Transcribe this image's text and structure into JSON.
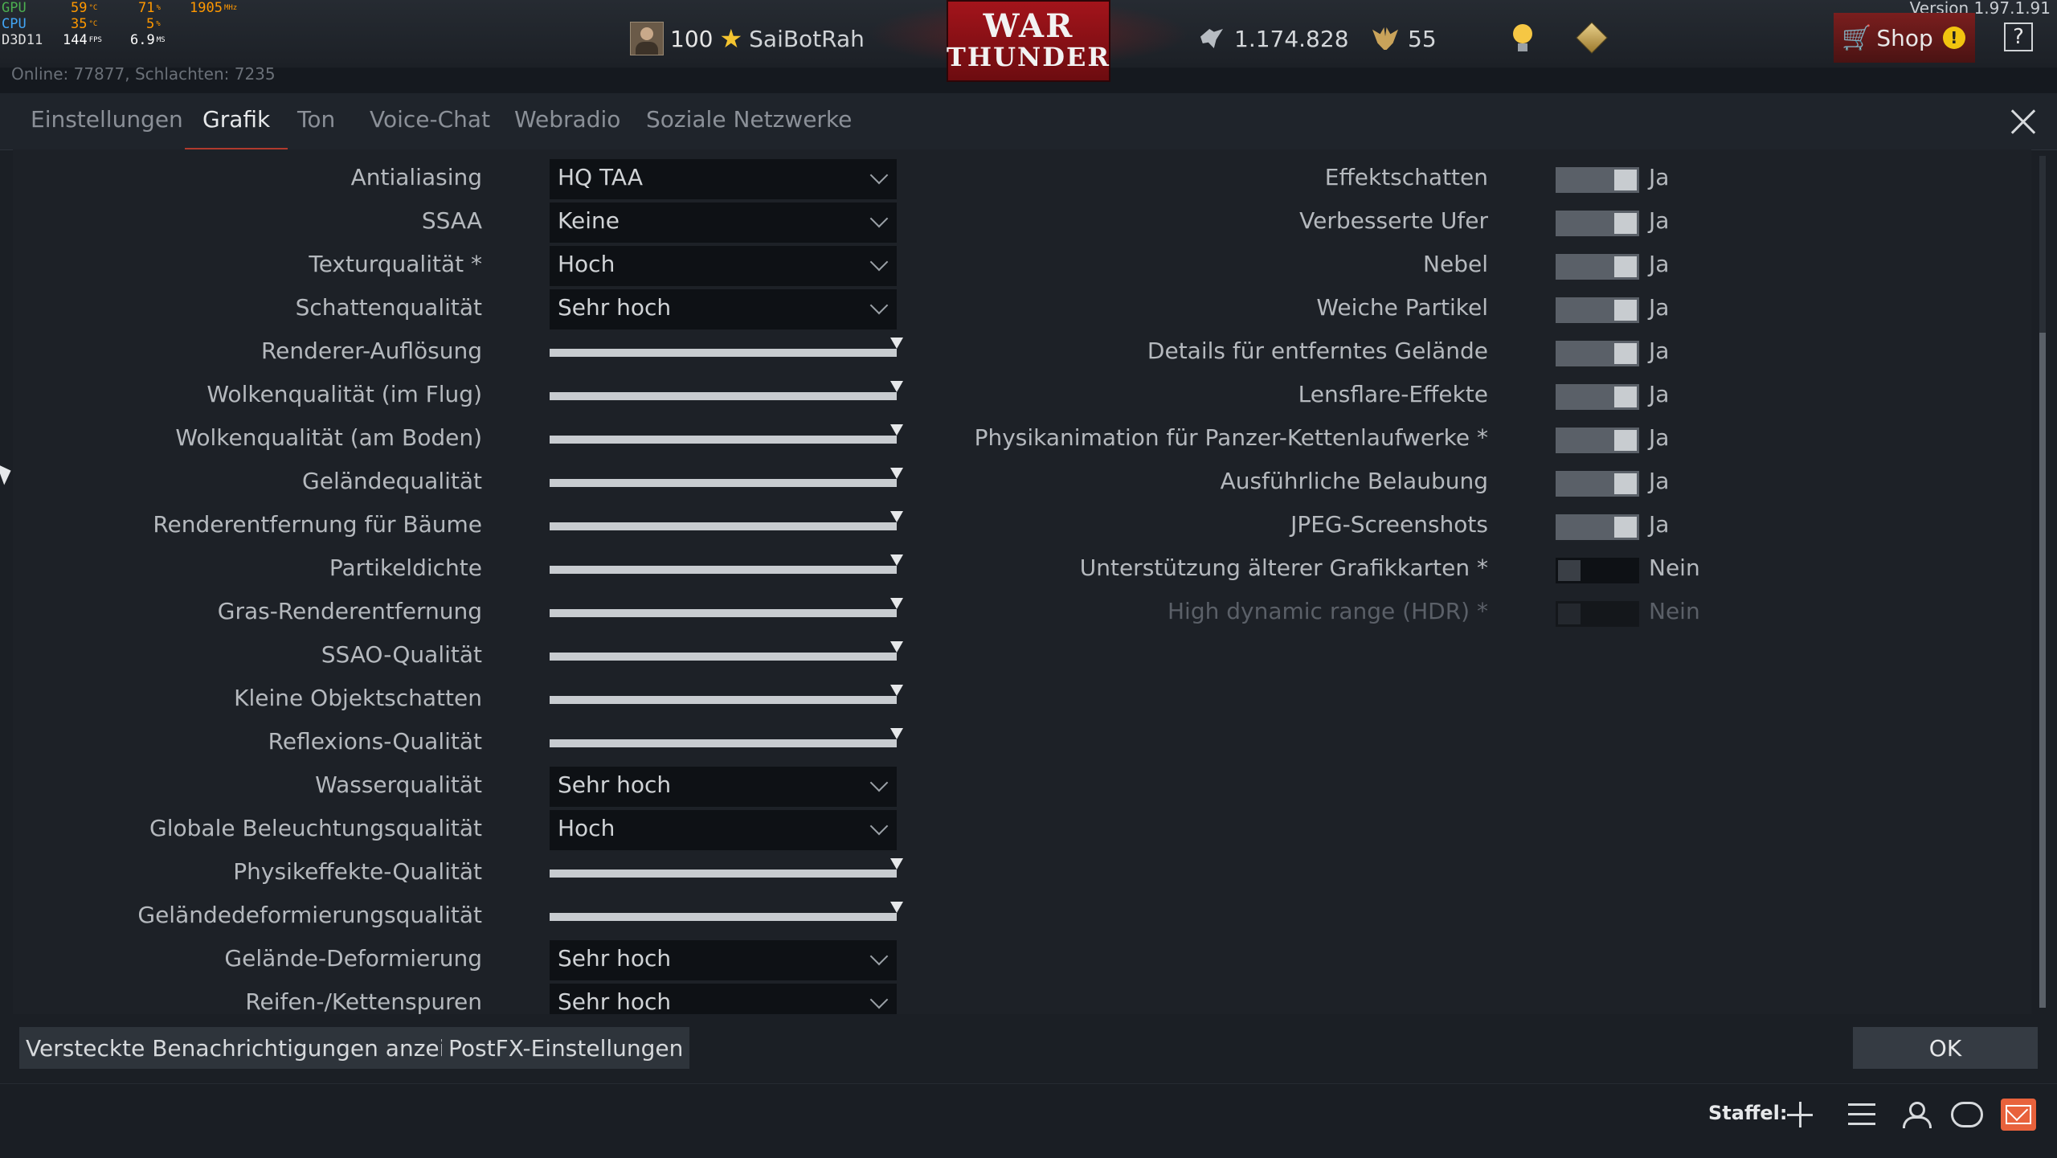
{
  "perf": {
    "gpu": {
      "label": "GPU",
      "temp": "59",
      "temp_unit": "°C",
      "load": "71",
      "load_unit": "%",
      "clock": "1905",
      "clock_unit": "MHz"
    },
    "cpu": {
      "label": "CPU",
      "temp": "35",
      "temp_unit": "°C",
      "load": "5",
      "load_unit": "%"
    },
    "d3d": {
      "label": "D3D11",
      "fps": "144",
      "fps_unit": "FPS",
      "ms": "6.9",
      "ms_unit": "MS"
    }
  },
  "online_text": "Online: 77877, Schlachten: 7235",
  "player": {
    "rank": "100",
    "nickname": "SaiBotRah"
  },
  "logo": {
    "line1": "WAR",
    "line2": "THUNDER"
  },
  "currency": {
    "silver_lions": "1.174.828",
    "golden_eagles": "55"
  },
  "version": "Version 1.97.1.91",
  "shop_label": "Shop",
  "help_label": "?",
  "tabs": [
    {
      "label": "Einstellungen"
    },
    {
      "label": "Grafik"
    },
    {
      "label": "Ton"
    },
    {
      "label": "Voice-Chat"
    },
    {
      "label": "Webradio"
    },
    {
      "label": "Soziale Netzwerke"
    }
  ],
  "active_tab": "Grafik",
  "left_settings": [
    {
      "label": "Antialiasing",
      "type": "dropdown",
      "value": "HQ TAA"
    },
    {
      "label": "SSAA",
      "type": "dropdown",
      "value": "Keine"
    },
    {
      "label": "Texturqualität *",
      "type": "dropdown",
      "value": "Hoch"
    },
    {
      "label": "Schattenqualität",
      "type": "dropdown",
      "value": "Sehr hoch"
    },
    {
      "label": "Renderer-Auflösung",
      "type": "slider",
      "level": 1.0
    },
    {
      "label": "Wolkenqualität (im Flug)",
      "type": "slider",
      "level": 1.0
    },
    {
      "label": "Wolkenqualität (am Boden)",
      "type": "slider",
      "level": 1.0
    },
    {
      "label": "Geländequalität",
      "type": "slider",
      "level": 1.0
    },
    {
      "label": "Renderentfernung für Bäume",
      "type": "slider",
      "level": 1.0
    },
    {
      "label": "Partikeldichte",
      "type": "slider",
      "level": 1.0
    },
    {
      "label": "Gras-Renderentfernung",
      "type": "slider",
      "level": 1.0
    },
    {
      "label": "SSAO-Qualität",
      "type": "slider",
      "level": 1.0
    },
    {
      "label": "Kleine Objektschatten",
      "type": "slider",
      "level": 1.0
    },
    {
      "label": "Reflexions-Qualität",
      "type": "slider",
      "level": 1.0
    },
    {
      "label": "Wasserqualität",
      "type": "dropdown",
      "value": "Sehr hoch"
    },
    {
      "label": "Globale Beleuchtungsqualität",
      "type": "dropdown",
      "value": "Hoch"
    },
    {
      "label": "Physikeffekte-Qualität",
      "type": "slider",
      "level": 1.0
    },
    {
      "label": "Geländedeformierungsqualität",
      "type": "slider",
      "level": 1.0
    },
    {
      "label": "Gelände-Deformierung",
      "type": "dropdown",
      "value": "Sehr hoch"
    },
    {
      "label": "Reifen-/Kettenspuren",
      "type": "dropdown",
      "value": "Sehr hoch"
    }
  ],
  "right_settings": [
    {
      "label": "Effektschatten",
      "state": "on",
      "value": "Ja"
    },
    {
      "label": "Verbesserte Ufer",
      "state": "on",
      "value": "Ja"
    },
    {
      "label": "Nebel",
      "state": "on",
      "value": "Ja"
    },
    {
      "label": "Weiche Partikel",
      "state": "on",
      "value": "Ja"
    },
    {
      "label": "Details für entferntes Gelände",
      "state": "on",
      "value": "Ja"
    },
    {
      "label": "Lensflare-Effekte",
      "state": "on",
      "value": "Ja"
    },
    {
      "label": "Physikanimation für Panzer-Kettenlaufwerke *",
      "state": "on",
      "value": "Ja"
    },
    {
      "label": "Ausführliche Belaubung",
      "state": "on",
      "value": "Ja"
    },
    {
      "label": "JPEG-Screenshots",
      "state": "on",
      "value": "Ja"
    },
    {
      "label": "Unterstützung älterer Grafikkarten *",
      "state": "off",
      "value": "Nein"
    },
    {
      "label": "High dynamic range (HDR) *",
      "state": "disabled",
      "value": "Nein"
    }
  ],
  "footer": {
    "hidden_notifications_label": "Versteckte Benachrichtigungen anzeigen",
    "postfx_label": "PostFX-Einstellungen",
    "ok_label": "OK"
  },
  "statusbar": {
    "squadron_label": "Staffel:"
  },
  "colors": {
    "accent": "#b03a2e",
    "background": "#1b1f25",
    "shop": "#7a1e1e",
    "mail": "#e8623c"
  }
}
